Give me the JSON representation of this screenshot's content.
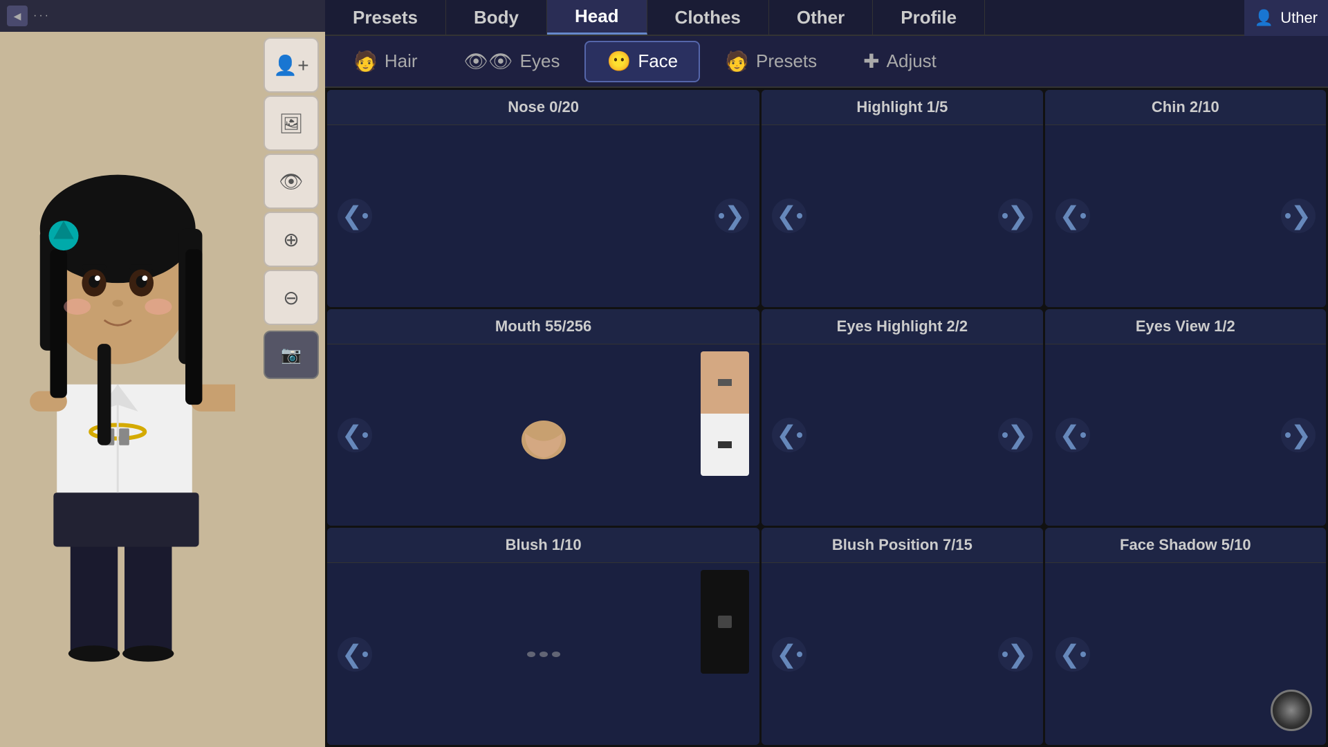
{
  "topNav": {
    "tabs": [
      {
        "id": "presets",
        "label": "Presets"
      },
      {
        "id": "body",
        "label": "Body"
      },
      {
        "id": "head",
        "label": "Head",
        "active": true
      },
      {
        "id": "clothes",
        "label": "Clothes"
      },
      {
        "id": "other",
        "label": "Other"
      },
      {
        "id": "profile",
        "label": "Profile"
      }
    ]
  },
  "subNav": {
    "tabs": [
      {
        "id": "hair",
        "label": "Hair",
        "icon": "🧑"
      },
      {
        "id": "eyes",
        "label": "Eyes",
        "icon": "👁"
      },
      {
        "id": "face",
        "label": "Face",
        "icon": "😶",
        "active": true
      },
      {
        "id": "presets",
        "label": "Presets",
        "icon": "🧑"
      },
      {
        "id": "adjust",
        "label": "Adjust",
        "icon": "✚"
      }
    ]
  },
  "features": [
    {
      "id": "nose",
      "label": "Nose 0/20",
      "hasPreview": false,
      "hasColorSwatch": false
    },
    {
      "id": "highlight",
      "label": "Highlight 1/5",
      "hasPreview": false,
      "hasColorSwatch": false
    },
    {
      "id": "chin",
      "label": "Chin 2/10",
      "hasPreview": false,
      "hasColorSwatch": false
    },
    {
      "id": "mouth",
      "label": "Mouth 55/256",
      "hasPreview": true,
      "hasSwatch": true,
      "swatchType": "skin"
    },
    {
      "id": "eyes-highlight",
      "label": "Eyes Highlight 2/2",
      "hasPreview": false,
      "hasColorSwatch": false
    },
    {
      "id": "eyes-view",
      "label": "Eyes View 1/2",
      "hasPreview": false,
      "hasColorSwatch": false
    },
    {
      "id": "blush",
      "label": "Blush 1/10",
      "hasPreview": false,
      "hasSwatch": true,
      "swatchType": "black"
    },
    {
      "id": "blush-position",
      "label": "Blush Position 7/15",
      "hasPreview": false,
      "hasColorSwatch": false
    },
    {
      "id": "face-shadow",
      "label": "Face Shadow 5/10",
      "hasPreview": false,
      "hasColorSwatch": false
    }
  ],
  "user": {
    "name": "Uther"
  },
  "toolbar": {
    "addUser": "add-user-icon",
    "gallery": "gallery-icon",
    "visibility": "eye-icon",
    "zoomIn": "zoom-in-icon",
    "zoomOut": "zoom-out-icon",
    "camera": "camera-icon"
  }
}
